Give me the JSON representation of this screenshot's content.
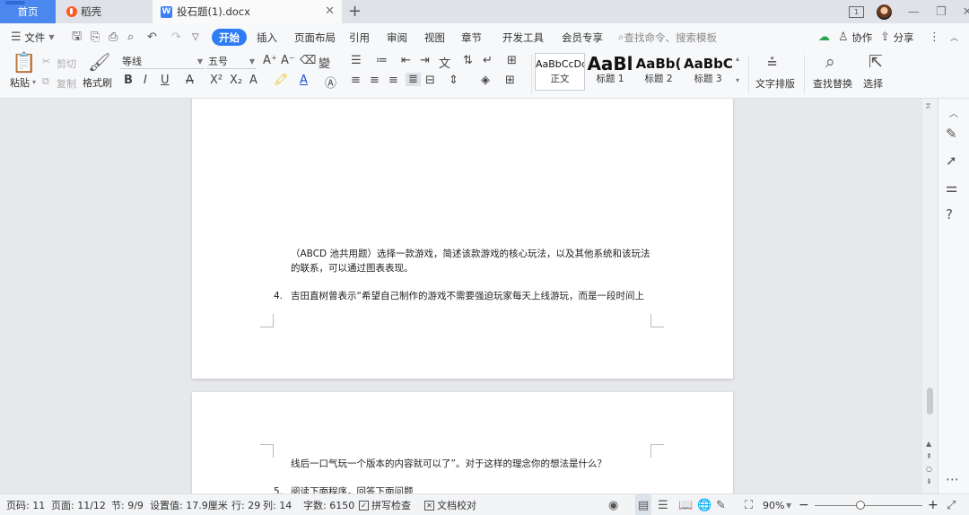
{
  "title_bar": {
    "tabs": [
      {
        "label": "首页"
      },
      {
        "label": "稻壳"
      },
      {
        "label": "投石题(1).docx"
      }
    ],
    "new_tab": "+",
    "page_indicator": "1"
  },
  "menu": {
    "file": "文件",
    "items": [
      "开始",
      "插入",
      "页面布局",
      "引用",
      "审阅",
      "视图",
      "章节",
      "开发工具",
      "会员专享"
    ],
    "active": "开始",
    "search_placeholder": "查找命令、搜索模板",
    "collab": "协作",
    "share": "分享"
  },
  "ribbon": {
    "paste": "粘贴",
    "cut": "剪切",
    "copy": "复制",
    "format_painter": "格式刷",
    "font_name": "等线",
    "font_size": "五号",
    "styles": [
      {
        "sample": "AaBbCcDd",
        "name": "正文"
      },
      {
        "sample": "AaBl",
        "name": "标题 1"
      },
      {
        "sample": "AaBb(",
        "name": "标题 2"
      },
      {
        "sample": "AaBbC",
        "name": "标题 3"
      }
    ],
    "text_layout": "文字排版",
    "find_replace": "查找替换",
    "select": "选择"
  },
  "document": {
    "page1": {
      "para_line1": "（ABCD 池共用题）选择一款游戏，简述该款游戏的核心玩法，以及其他系统和该玩法",
      "para_line2": "的联系，可以通过图表表现。",
      "item4_num": "4.",
      "item4_line1": "吉田直树曾表示“希望自己制作的游戏不需要强迫玩家每天上线游玩，而是一段时间上"
    },
    "page2": {
      "item4_line2": "线后一口气玩一个版本的内容就可以了”。对于这样的理念你的想法是什么？",
      "item5_num": "5.",
      "item5_line1": "阅读下面程序，回答下面问题"
    }
  },
  "status": {
    "page_code": "页码: 11",
    "page": "页面: 11/12",
    "section": "节: 9/9",
    "setting": "设置值: 17.9厘米",
    "row": "行: 29",
    "col": "列: 14",
    "word_count": "字数: 6150",
    "spell_check": "拼写检查",
    "doc_proof": "文档校对",
    "zoom": "90%"
  }
}
